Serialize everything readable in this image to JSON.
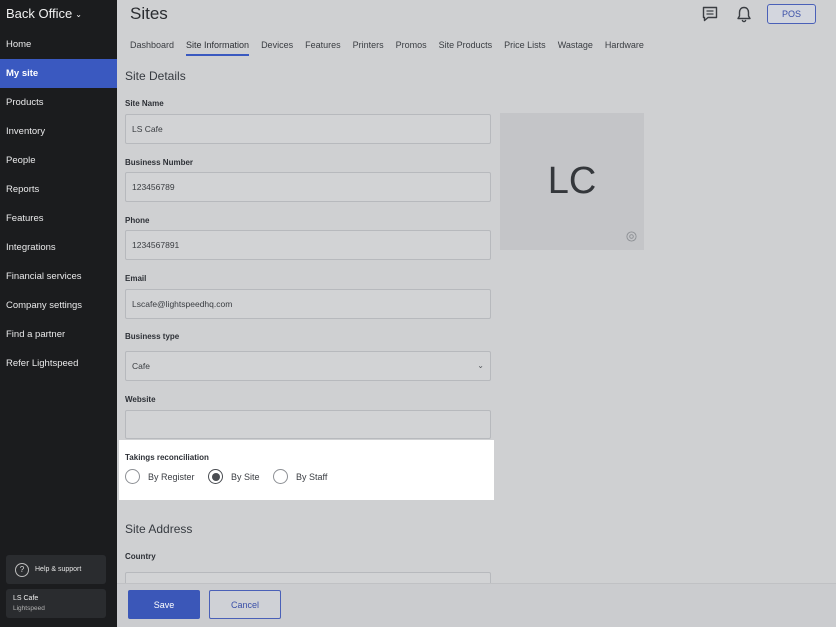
{
  "sidebar": {
    "brand": "Back Office",
    "items": [
      {
        "label": "Home"
      },
      {
        "label": "My site"
      },
      {
        "label": "Products"
      },
      {
        "label": "Inventory"
      },
      {
        "label": "People"
      },
      {
        "label": "Reports"
      },
      {
        "label": "Features"
      },
      {
        "label": "Integrations"
      },
      {
        "label": "Financial services"
      },
      {
        "label": "Company settings"
      },
      {
        "label": "Find a partner"
      },
      {
        "label": "Refer Lightspeed"
      }
    ],
    "active_item": "My site",
    "help_label": "Help & support",
    "account": {
      "name": "LS Cafe",
      "org": "Lightspeed"
    }
  },
  "header": {
    "title": "Sites",
    "icons": [
      "chat-icon",
      "bell-icon"
    ],
    "pos_label": "POS"
  },
  "tabs": [
    {
      "label": "Dashboard"
    },
    {
      "label": "Site Information"
    },
    {
      "label": "Devices"
    },
    {
      "label": "Features"
    },
    {
      "label": "Printers"
    },
    {
      "label": "Promos"
    },
    {
      "label": "Site Products"
    },
    {
      "label": "Price Lists"
    },
    {
      "label": "Wastage"
    },
    {
      "label": "Hardware"
    }
  ],
  "active_tab": "Site Information",
  "site_details": {
    "title": "Site Details",
    "site_name": {
      "label": "Site Name",
      "value": "LS Cafe"
    },
    "business_number": {
      "label": "Business Number",
      "value": "123456789"
    },
    "phone": {
      "label": "Phone",
      "value": "1234567891"
    },
    "email": {
      "label": "Email",
      "value": "Lscafe@lightspeedhq.com"
    },
    "business_type": {
      "label": "Business type",
      "value": "Cafe"
    },
    "website": {
      "label": "Website",
      "value": ""
    },
    "logo_initials": "LC"
  },
  "takings": {
    "label": "Takings reconciliation",
    "options": [
      {
        "label": "By Register",
        "selected": false
      },
      {
        "label": "By Site",
        "selected": true
      },
      {
        "label": "By Staff",
        "selected": false
      }
    ]
  },
  "site_address": {
    "title": "Site Address",
    "country_label": "Country"
  },
  "footer": {
    "save_label": "Save",
    "cancel_label": "Cancel"
  },
  "colors": {
    "accent": "#3b57b8",
    "sidebar_bg": "#1b1c1e",
    "overlay_bg": "#cfd0d2"
  }
}
